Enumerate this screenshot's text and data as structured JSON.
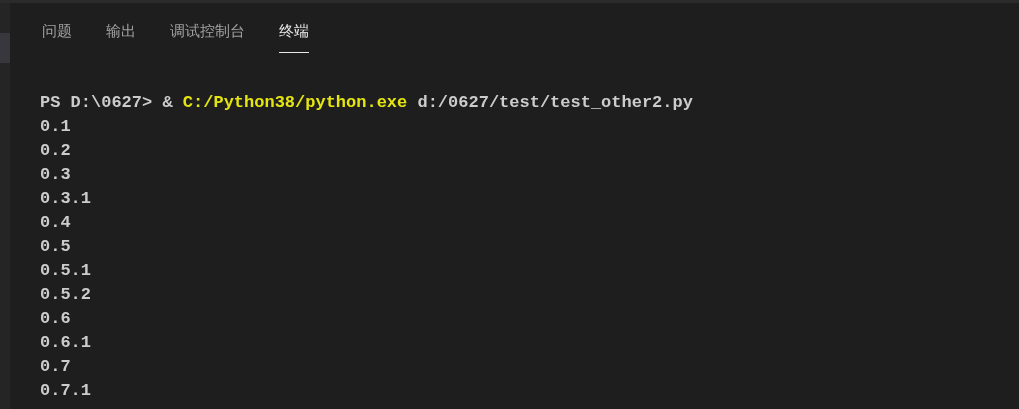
{
  "tabs": [
    {
      "label": "问题",
      "selected": false
    },
    {
      "label": "输出",
      "selected": false
    },
    {
      "label": "调试控制台",
      "selected": false
    },
    {
      "label": "终端",
      "selected": true
    }
  ],
  "terminal": {
    "prompt": [
      {
        "kind": "plain",
        "text": "PS D:\\0627> & "
      },
      {
        "kind": "command",
        "text": "C:/Python38/python.exe"
      },
      {
        "kind": "plain",
        "text": " d:/0627/test/test_other2.py"
      }
    ],
    "lines": [
      "0.1",
      "0.2",
      "0.3",
      "0.3.1",
      "0.4",
      "0.5",
      "0.5.1",
      "0.5.2",
      "0.6",
      "0.6.1",
      "0.7",
      "0.7.1"
    ]
  }
}
